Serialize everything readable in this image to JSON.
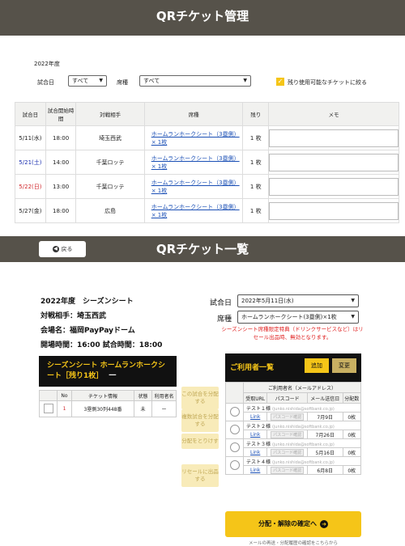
{
  "panel1": {
    "title": "QRチケット管理",
    "season": "2022年度",
    "filter_game_label": "試合日",
    "filter_game_value": "すべて",
    "filter_seat_label": "席種",
    "filter_seat_value": "すべて",
    "checkbox_label": "残り使用可能なチケットに絞る",
    "columns": [
      "試合日",
      "試合開始時間",
      "対戦相手",
      "席種",
      "残り",
      "メモ"
    ],
    "rows": [
      {
        "date": "5/11(水)",
        "time": "18:00",
        "opponent": "埼玉西武",
        "seat": "ホームランホークシート（3塁側）× 1枚",
        "remaining": "1 枚",
        "day": "wd"
      },
      {
        "date": "5/21(土)",
        "time": "14:00",
        "opponent": "千葉ロッテ",
        "seat": "ホームランホークシート（3塁側）× 1枚",
        "remaining": "1 枚",
        "day": "sat"
      },
      {
        "date": "5/22(日)",
        "time": "13:00",
        "opponent": "千葉ロッテ",
        "seat": "ホームランホークシート（3塁側）× 1枚",
        "remaining": "1 枚",
        "day": "sun"
      },
      {
        "date": "5/27(金)",
        "time": "18:00",
        "opponent": "広島",
        "seat": "ホームランホークシート（3塁側）× 1枚",
        "remaining": "1 枚",
        "day": "wd"
      }
    ]
  },
  "panel2": {
    "title": "QRチケット一覧",
    "back_label": "戻る",
    "info_season": "2022年度　シーズンシート",
    "info_opponent": "対戦相手：埼玉西武",
    "info_venue": "会場名：福岡PayPayドーム",
    "info_time": "開場時間：16:00 試合時間：18:00",
    "ticket_box_title": "シーズンシート ホームランホークシート［残り1枚］",
    "ticket_box_suffix": "一",
    "ticket_columns": [
      "No",
      "チケット情報",
      "状態",
      "利用者名"
    ],
    "ticket_rows": [
      {
        "no": "1",
        "info": "3塁側30列448番",
        "status": "未",
        "user": "ー"
      }
    ],
    "side_buttons": [
      "この試合を分配する",
      "複数試合を分配する",
      "分配をとりけす",
      "リセールに出品する"
    ],
    "date_label": "試合日",
    "date_value": "2022年5月11日(水)",
    "seat_label": "席種",
    "seat_value": "ホームランホークシート(3塁側)×1枚",
    "warning": "シーズンシート席種限定特典（ドリンクサービスなど）はリセール出品時、無効となります。",
    "users_title": "ご利用者一覧",
    "add_label": "追加",
    "change_label": "変更",
    "user_header": "ご利用者名（メールアドレス）",
    "user_columns": [
      "受取URL",
      "パスコード",
      "メール送信日",
      "分配数"
    ],
    "users": [
      {
        "name": "テスト１様",
        "email": "(junko.nishida@softbank.co.jp)",
        "link": "Link",
        "passcode": "パスコード確認",
        "sent": "7月9日",
        "count": "0枚"
      },
      {
        "name": "テスト２様",
        "email": "(junko.nishida@softbank.co.jp)",
        "link": "Link",
        "passcode": "パスコード確認",
        "sent": "7月26日",
        "count": "0枚"
      },
      {
        "name": "テスト３様",
        "email": "(junko.nishida@softbank.co.jp)",
        "link": "Link",
        "passcode": "パスコード確認",
        "sent": "5月16日",
        "count": "0枚"
      },
      {
        "name": "テスト４様",
        "email": "(junko.nishida@softbank.co.jp)",
        "link": "Link",
        "passcode": "パスコード確認",
        "sent": "6月8日",
        "count": "0枚"
      }
    ],
    "confirm_label": "分配・解除の確定へ",
    "footer_note": "メールの再送・分配履歴の確認をこちらから"
  },
  "colors": {
    "header_bg": "#56524a",
    "accent_yellow": "#f5c518",
    "link_blue": "#1a4fb5",
    "warning_red": "#e02020"
  }
}
